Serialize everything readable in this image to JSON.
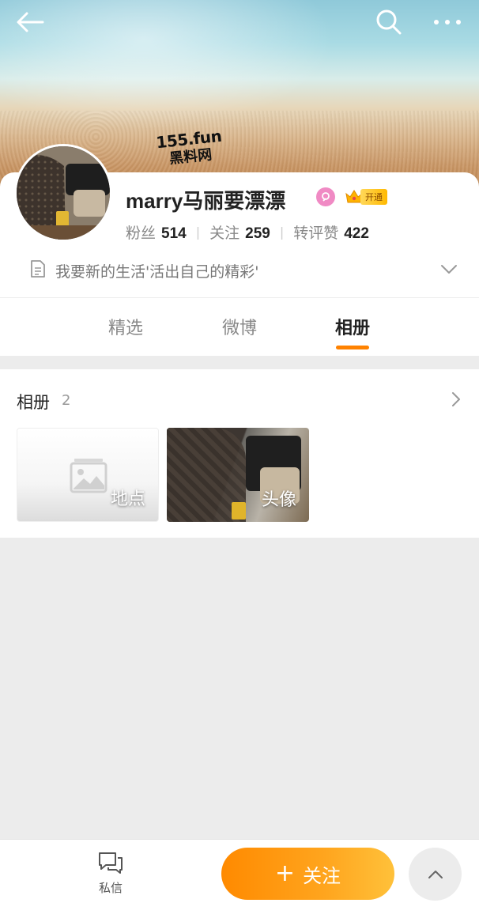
{
  "header": {
    "back_icon": "arrow-left-icon",
    "search_icon": "search-icon",
    "more_icon": "more-dots-icon"
  },
  "watermark": {
    "line1": "155.fun",
    "line2": "黑料网"
  },
  "profile": {
    "name": "marry马丽要漂漂",
    "vip_label": "开通",
    "stats": [
      {
        "label": "粉丝",
        "value": "514"
      },
      {
        "label": "关注",
        "value": "259"
      },
      {
        "label": "转评赞",
        "value": "422"
      }
    ],
    "bio": "我要新的生活'活出自己的精彩'"
  },
  "tabs": [
    {
      "label": "精选",
      "active": false
    },
    {
      "label": "微博",
      "active": false
    },
    {
      "label": "相册",
      "active": true
    }
  ],
  "album": {
    "title": "相册",
    "count": "2",
    "items": [
      {
        "label": "地点"
      },
      {
        "label": "头像"
      }
    ]
  },
  "bottom_bar": {
    "dm_label": "私信",
    "follow_label": "关注"
  },
  "colors": {
    "accent": "#ff8200",
    "follow_gradient_start": "#ff8a00",
    "follow_gradient_end": "#ffc13a",
    "background": "#ececec"
  }
}
